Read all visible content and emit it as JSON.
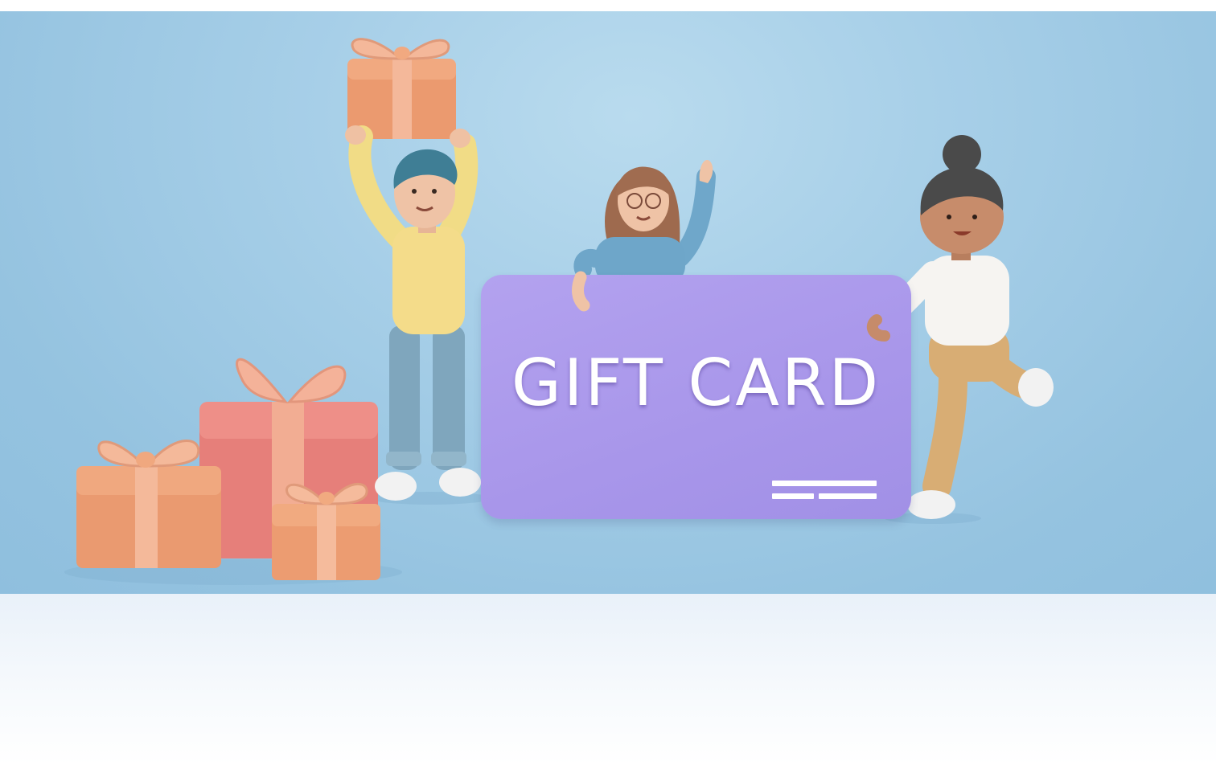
{
  "banner": {
    "card_title": "GIFT CARD",
    "colors": {
      "background": "#a7cfe8",
      "card": "#ab9aeb",
      "gift_box": "#e9936a",
      "gift_box_pink": "#e87a75",
      "ribbon": "#f0b08f"
    },
    "illustration": {
      "characters": [
        "man-holding-gift",
        "woman-with-glasses-waving",
        "woman-with-bun-running"
      ],
      "gift_box_count": 4
    }
  }
}
